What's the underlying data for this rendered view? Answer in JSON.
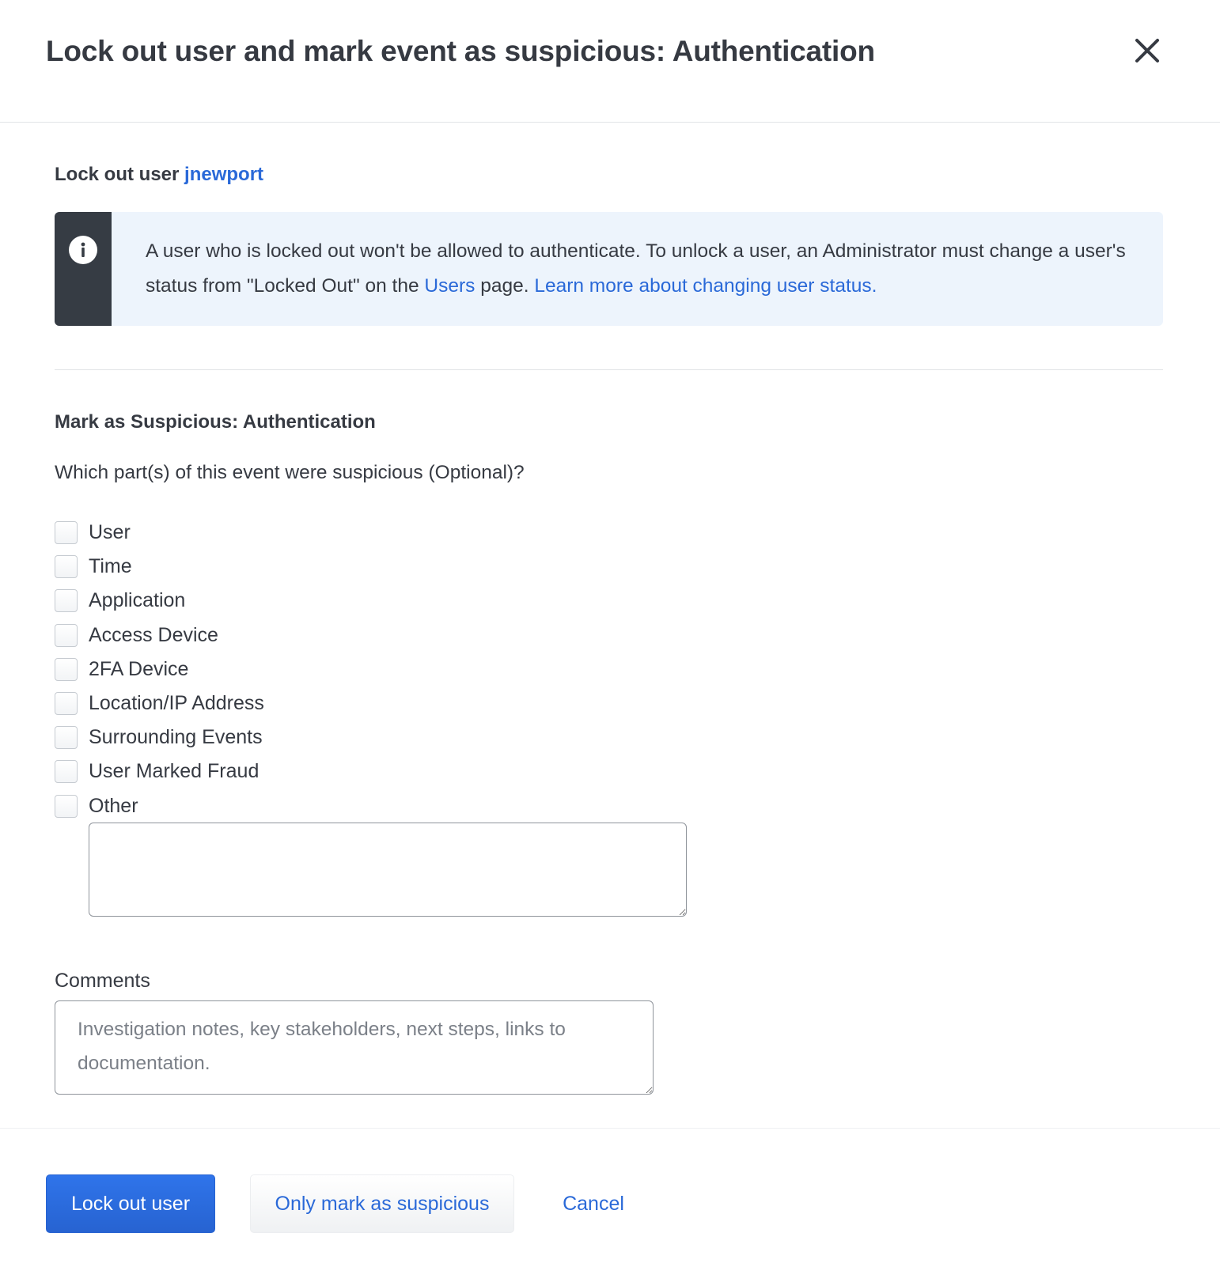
{
  "modal": {
    "title": "Lock out user and mark event as suspicious: Authentication",
    "close_icon": "close-icon"
  },
  "lockout": {
    "heading_prefix": "Lock out user",
    "username": "jnewport",
    "alert": {
      "icon": "info-icon",
      "text_part1": "A user who is locked out won't be allowed to authenticate. To unlock a user, an Administrator must change a user's status from \"Locked Out\" on the",
      "users_link": "Users",
      "text_part2": "page.",
      "learn_more_link": "Learn more about changing user status."
    }
  },
  "suspicious": {
    "heading": "Mark as Suspicious: Authentication",
    "question": "Which part(s) of this event were suspicious (Optional)?",
    "options": [
      {
        "label": "User",
        "checked": false
      },
      {
        "label": "Time",
        "checked": false
      },
      {
        "label": "Application",
        "checked": false
      },
      {
        "label": "Access Device",
        "checked": false
      },
      {
        "label": "2FA Device",
        "checked": false
      },
      {
        "label": "Location/IP Address",
        "checked": false
      },
      {
        "label": "Surrounding Events",
        "checked": false
      },
      {
        "label": "User Marked Fraud",
        "checked": false
      },
      {
        "label": "Other",
        "checked": false
      }
    ],
    "other_value": ""
  },
  "comments": {
    "label": "Comments",
    "value": "",
    "placeholder": "Investigation notes, key stakeholders, next steps, links to documentation."
  },
  "footer": {
    "primary_label": "Lock out user",
    "secondary_label": "Only mark as suspicious",
    "cancel_label": "Cancel"
  },
  "colors": {
    "text": "#363a42",
    "link": "#2a69d8",
    "primary_button": "#2a6ce0",
    "alert_background": "#edf4fc",
    "alert_bar": "#363c44"
  }
}
